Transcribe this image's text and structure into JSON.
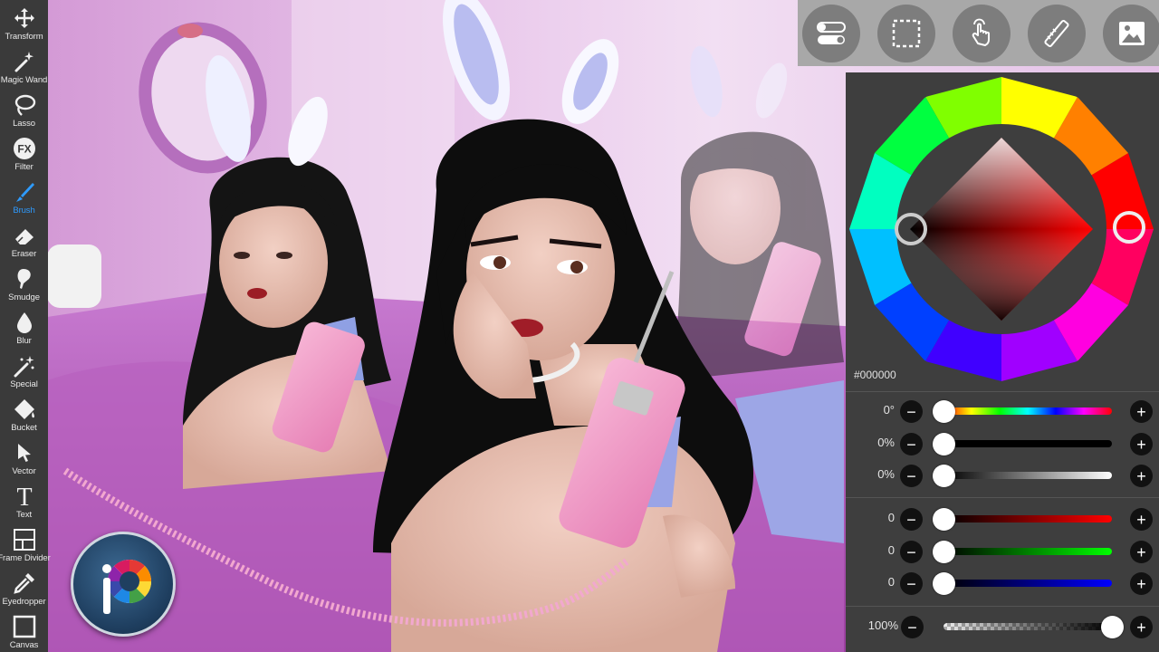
{
  "app": {
    "name": "ibis Paint"
  },
  "toolbar": {
    "tools": [
      {
        "label": "Transform",
        "icon": "transform-icon"
      },
      {
        "label": "Magic Wand",
        "icon": "magic-wand-icon"
      },
      {
        "label": "Lasso",
        "icon": "lasso-icon"
      },
      {
        "label": "Filter",
        "icon": "filter-icon"
      },
      {
        "label": "Brush",
        "icon": "brush-icon",
        "active": true
      },
      {
        "label": "Eraser",
        "icon": "eraser-icon"
      },
      {
        "label": "Smudge",
        "icon": "smudge-icon"
      },
      {
        "label": "Blur",
        "icon": "blur-icon"
      },
      {
        "label": "Special",
        "icon": "special-icon"
      },
      {
        "label": "Bucket",
        "icon": "bucket-icon"
      },
      {
        "label": "Vector",
        "icon": "vector-icon"
      },
      {
        "label": "Text",
        "icon": "text-icon"
      },
      {
        "label": "Frame Divider",
        "icon": "frame-divider-icon"
      },
      {
        "label": "Eyedropper",
        "icon": "eyedropper-icon"
      },
      {
        "label": "Canvas",
        "icon": "canvas-icon"
      }
    ],
    "filter_glyph": "FX",
    "text_glyph": "T"
  },
  "topbar": {
    "buttons": [
      {
        "icon": "toggle-settings-icon"
      },
      {
        "icon": "selection-icon"
      },
      {
        "icon": "touch-icon"
      },
      {
        "icon": "ruler-icon"
      },
      {
        "icon": "image-icon"
      }
    ]
  },
  "color_panel": {
    "hex": "#000000",
    "selected_color": "#000000",
    "hsb": [
      {
        "label": "0°",
        "position": 0
      },
      {
        "label": "0%",
        "position": 0
      },
      {
        "label": "0%",
        "position": 0
      }
    ],
    "rgb": [
      {
        "label": "0",
        "position": 0
      },
      {
        "label": "0",
        "position": 0
      },
      {
        "label": "0",
        "position": 0
      }
    ],
    "opacity": {
      "label": "100%",
      "position": 1
    },
    "minus_glyph": "−",
    "plus_glyph": "+"
  },
  "colors": {
    "toolbar_bg": "#3a3a3a",
    "active_tool": "#2e9bff",
    "panel_bg": "#3e3e3e",
    "topbar_bg": "#a8a8a8"
  },
  "logo": {
    "text": "iP"
  }
}
